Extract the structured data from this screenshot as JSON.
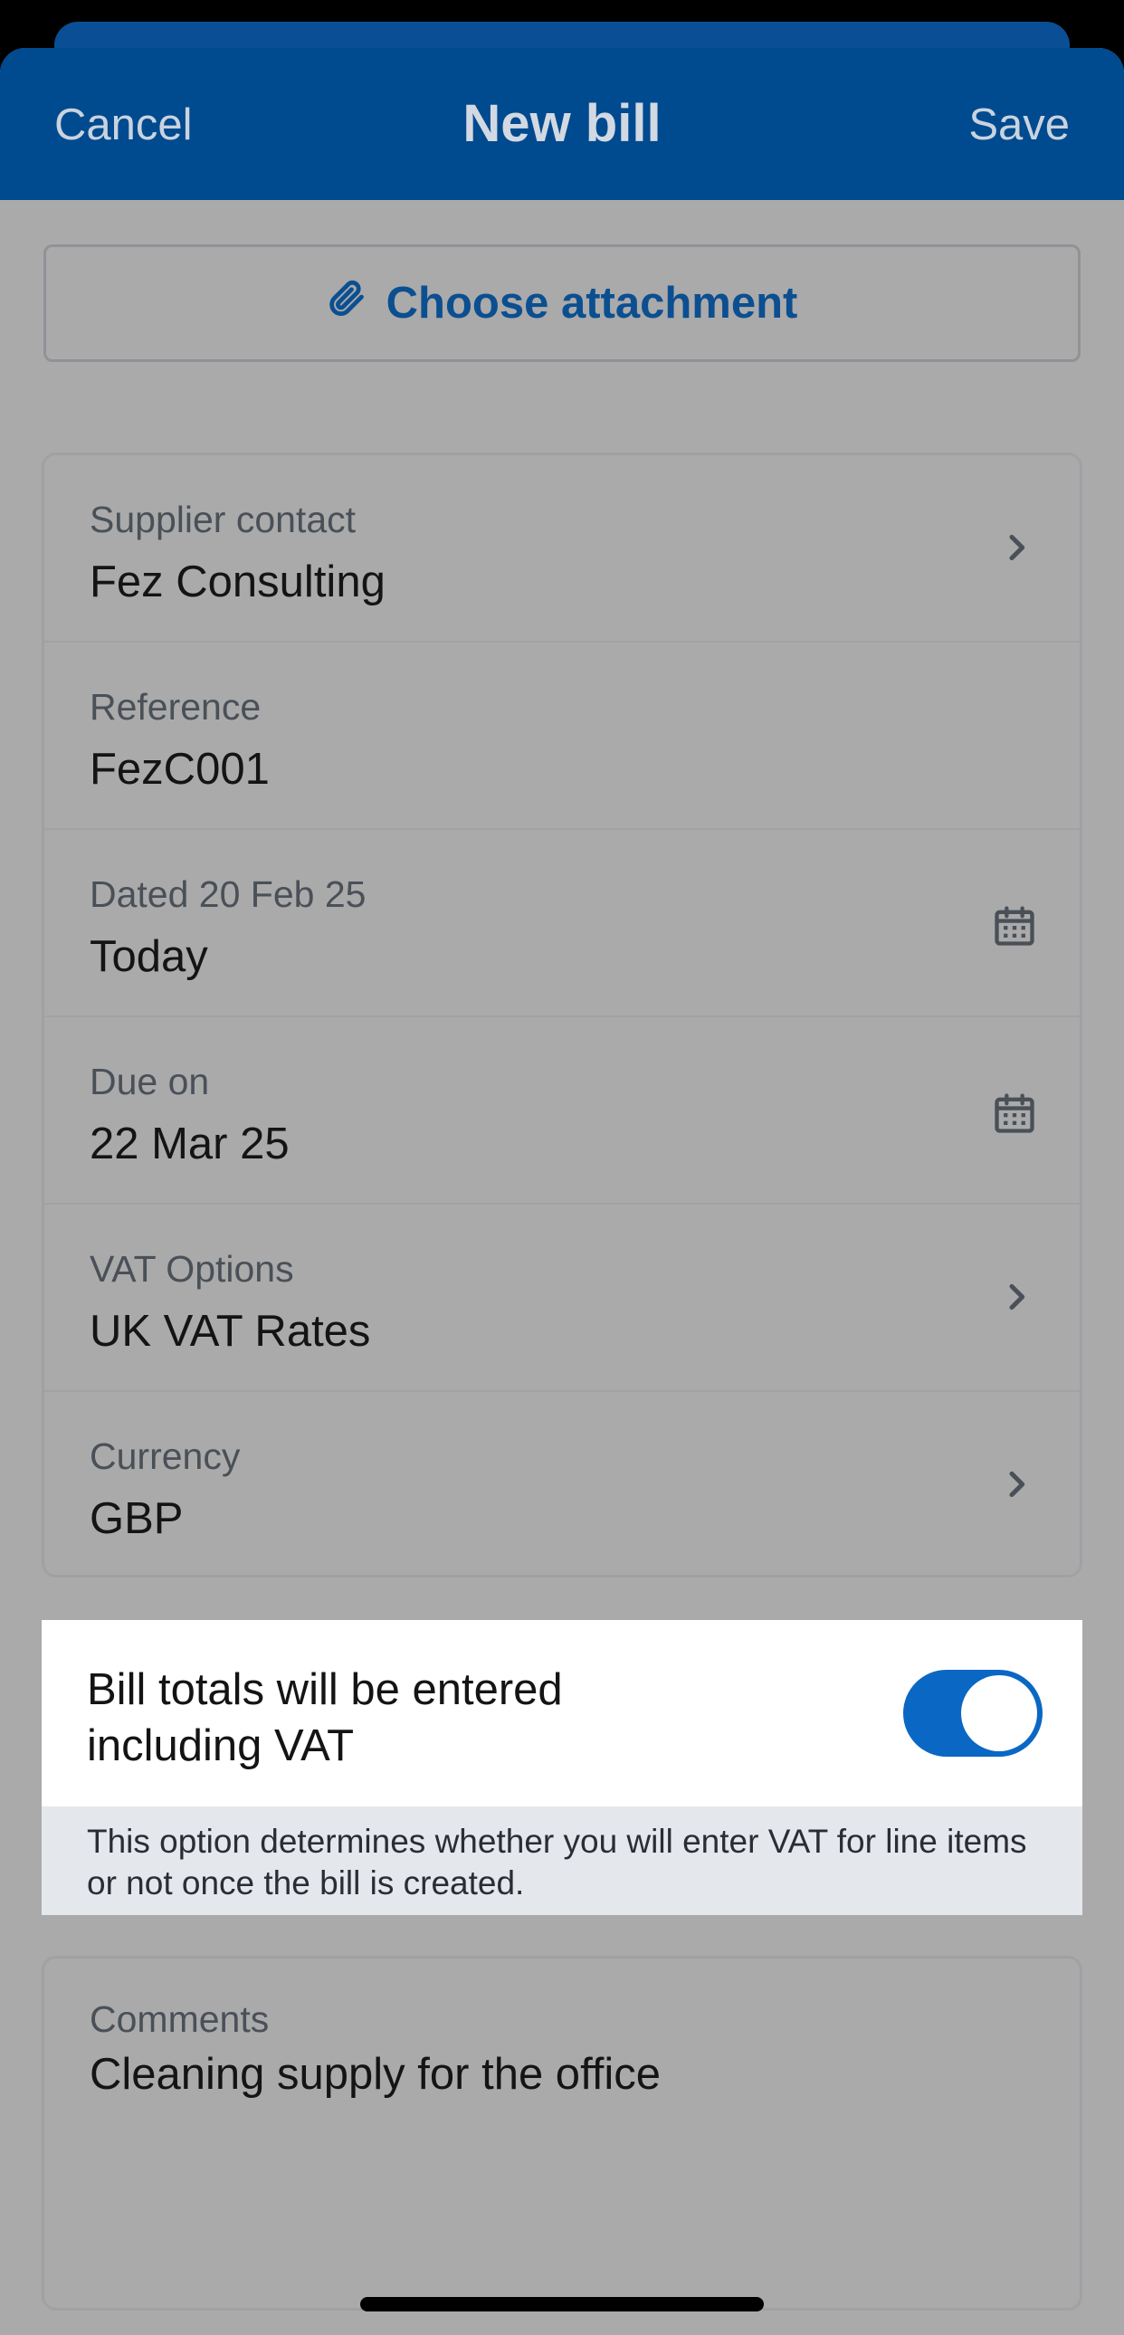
{
  "nav": {
    "cancel_label": "Cancel",
    "title": "New bill",
    "save_label": "Save"
  },
  "attachment": {
    "label": "Choose attachment",
    "icon": "paperclip-icon"
  },
  "fields": [
    {
      "label": "Supplier contact",
      "value": "Fez Consulting",
      "icon": "chevron-right-icon"
    },
    {
      "label": "Reference",
      "value": "FezC001"
    },
    {
      "label": "Dated 20 Feb 25",
      "value": "Today",
      "icon": "calendar-icon"
    },
    {
      "label": "Due on",
      "value": "22 Mar 25",
      "icon": "calendar-icon"
    },
    {
      "label": "VAT Options",
      "value": "UK VAT Rates",
      "icon": "chevron-right-icon"
    },
    {
      "label": "Currency",
      "value": "GBP",
      "icon": "chevron-right-icon"
    }
  ],
  "vat_toggle": {
    "label": "Bill totals will be entered including VAT",
    "checked": true,
    "note": "This option determines whether you will enter VAT for line items or not once the bill is created."
  },
  "comments": {
    "label": "Comments",
    "value": "Cleaning supply for the office"
  },
  "colors": {
    "header": "#004a8f",
    "accent": "#0b4f91",
    "toggle_on": "#0a67c4"
  }
}
